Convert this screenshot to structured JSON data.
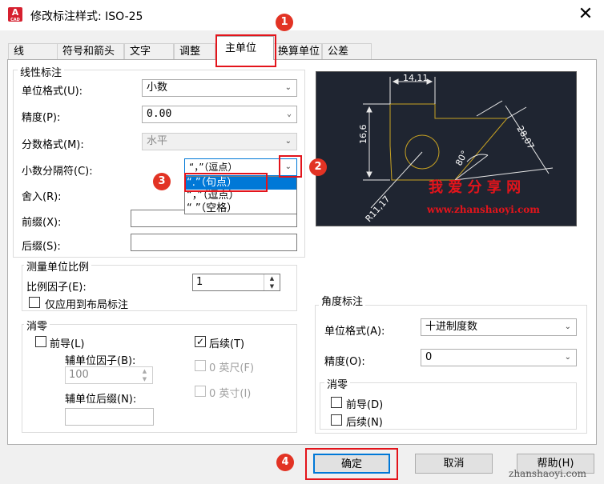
{
  "window": {
    "title": "修改标注样式: ISO-25",
    "close": "✕",
    "app_icon": "A",
    "app_icon_sub": "CAD"
  },
  "tabs": [
    "线",
    "符号和箭头",
    "文字",
    "调整",
    "主单位",
    "换算单位",
    "公差"
  ],
  "active_tab": "主单位",
  "linear": {
    "group": "线性标注",
    "unit_format_label": "单位格式(U):",
    "unit_format_value": "小数",
    "precision_label": "精度(P):",
    "precision_value": "0.00",
    "fraction_label": "分数格式(M):",
    "fraction_value": "水平",
    "decimal_sep_label": "小数分隔符(C):",
    "decimal_sep_value": "“，”（逗点）",
    "round_label": "舍入(R):",
    "prefix_label": "前缀(X):",
    "suffix_label": "后缀(S):"
  },
  "separator_options": [
    "“.”（句点）",
    "“，”（逗点）",
    "“ ”（空格）"
  ],
  "scale": {
    "group": "测量单位比例",
    "factor_label": "比例因子(E):",
    "factor_value": "1",
    "layout_only": "仅应用到布局标注"
  },
  "zero_linear": {
    "group": "消零",
    "leading": "前导(L)",
    "sub_factor_label": "辅单位因子(B):",
    "sub_factor_value": "100",
    "sub_suffix_label": "辅单位后缀(N):",
    "trailing": "后续(T)",
    "trailing_check": "✓",
    "feet": "0 英尺(F)",
    "inches": "0 英寸(I)"
  },
  "angular": {
    "group": "角度标注",
    "unit_format_label": "单位格式(A):",
    "unit_format_value": "十进制度数",
    "precision_label": "精度(O):",
    "precision_value": "0",
    "zero_group": "消零",
    "leading": "前导(D)",
    "trailing": "后续(N)"
  },
  "preview": {
    "dim_top": "14,11",
    "dim_left": "16,6",
    "dim_diag": "28,07",
    "dim_angle": "80°",
    "dim_radius": "R11,17",
    "watermark_cn": "我 爱 分 享 网",
    "watermark_url": "www.zhanshaoyi.com"
  },
  "buttons": {
    "ok": "确定",
    "cancel": "取消",
    "help": "帮助(H)"
  },
  "footer_watermark": "zhanshaoyi.com",
  "annotations": [
    "1",
    "2",
    "3",
    "4"
  ],
  "colors": {
    "accent": "#0078d7",
    "callout_red": "#e3141b",
    "preview_bg": "#1f2531"
  }
}
